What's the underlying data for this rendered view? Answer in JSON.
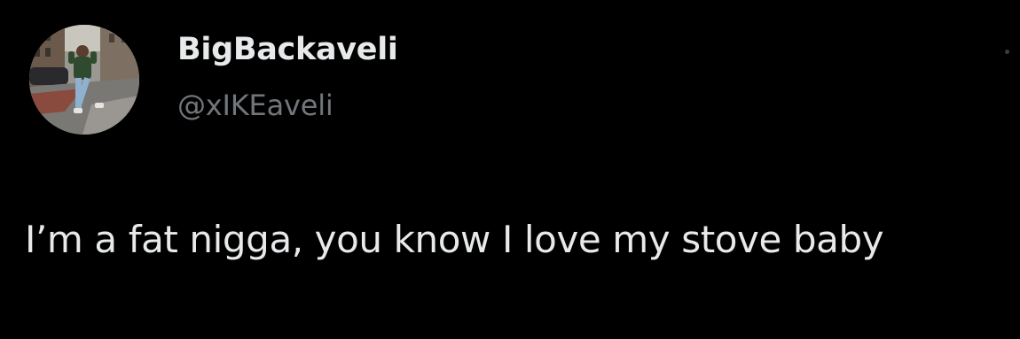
{
  "tweet": {
    "author": {
      "display_name": "BigBackaveli",
      "handle": "@xIKEaveli",
      "avatar_icon": "profile-photo"
    },
    "text": "I’m a fat nigga, you know I love my stove baby",
    "more_icon": "more-options-icon"
  },
  "colors": {
    "background": "#000000",
    "primary_text": "#e7e9ea",
    "secondary_text": "#71767b"
  }
}
